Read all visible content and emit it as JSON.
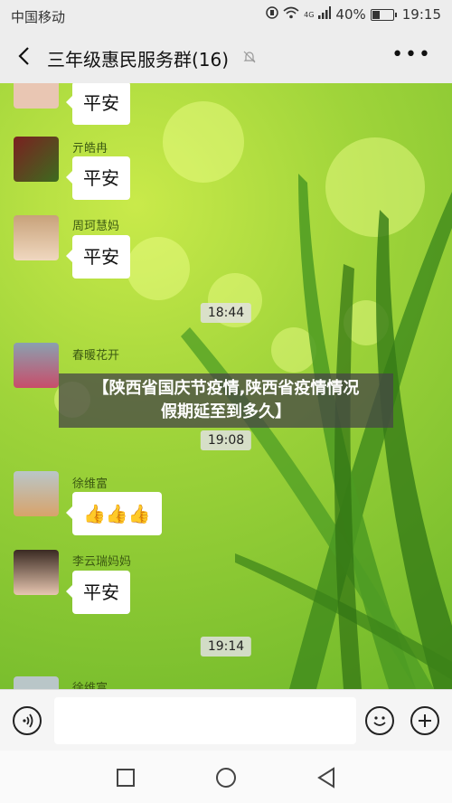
{
  "status_bar": {
    "carrier": "中国移动",
    "network": "4G",
    "battery": "40%",
    "time": "19:15"
  },
  "header": {
    "title": "三年级惠民服务群(16)",
    "more_label": "•••"
  },
  "messages": [
    {
      "sender": "",
      "text": "平安"
    },
    {
      "sender": "亓皓冉",
      "text": "平安"
    },
    {
      "sender": "周珂慧妈",
      "text": "平安"
    },
    {
      "time": "18:44"
    },
    {
      "sender": "春暖花开",
      "text": ""
    },
    {
      "time": "19:08"
    },
    {
      "sender": "徐维富",
      "text": "👍👍👍"
    },
    {
      "sender": "李云瑞妈妈",
      "text": "平安"
    },
    {
      "time": "19:14"
    },
    {
      "sender": "徐维富",
      "text": ""
    }
  ],
  "overlay": {
    "line1": "【陕西省国庆节疫情,陕西省疫情情况",
    "line2": "假期延至到多久】"
  },
  "colors": {
    "background_green": "#9fd43a",
    "bubble": "#ffffff"
  }
}
